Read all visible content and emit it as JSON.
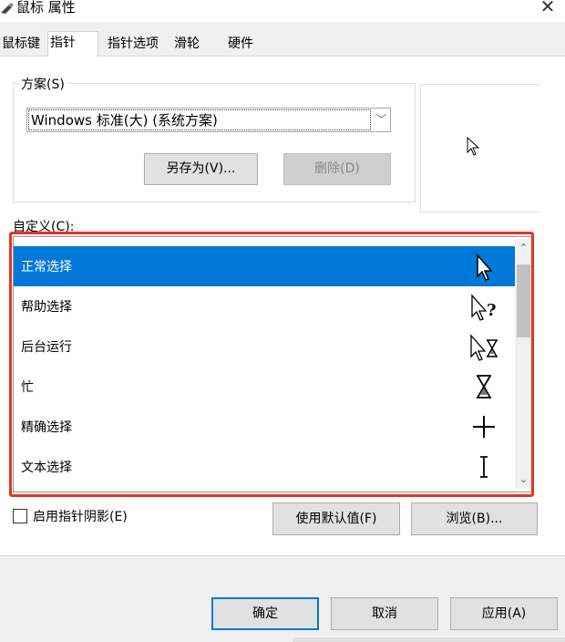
{
  "window": {
    "title": "鼠标 属性",
    "close_glyph": "✕"
  },
  "tabs": [
    {
      "label": "鼠标键",
      "active": false
    },
    {
      "label": "指针",
      "active": true
    },
    {
      "label": "指针选项",
      "active": false
    },
    {
      "label": "滑轮",
      "active": false
    },
    {
      "label": "硬件",
      "active": false
    }
  ],
  "scheme": {
    "legend": "方案(S)",
    "selected": "Windows 标准(大) (系统方案)",
    "save_as_label": "另存为(V)...",
    "delete_label": "删除(D)"
  },
  "custom": {
    "label": "自定义(C):",
    "items": [
      {
        "label": "正常选择",
        "icon": "arrow-cursor-icon",
        "selected": true
      },
      {
        "label": "帮助选择",
        "icon": "help-cursor-icon",
        "selected": false
      },
      {
        "label": "后台运行",
        "icon": "working-cursor-icon",
        "selected": false
      },
      {
        "label": "忙",
        "icon": "busy-hourglass-icon",
        "selected": false
      },
      {
        "label": "精确选择",
        "icon": "crosshair-cursor-icon",
        "selected": false
      },
      {
        "label": "文本选择",
        "icon": "ibeam-cursor-icon",
        "selected": false
      }
    ]
  },
  "options": {
    "shadow_label": "启用指针阴影(E)",
    "shadow_checked": false,
    "use_default_label": "使用默认值(F)",
    "browse_label": "浏览(B)..."
  },
  "footer": {
    "ok_label": "确定",
    "cancel_label": "取消",
    "apply_label": "应用(A)"
  },
  "colors": {
    "selection": "#0078d7",
    "highlight_frame": "#e8321e"
  }
}
